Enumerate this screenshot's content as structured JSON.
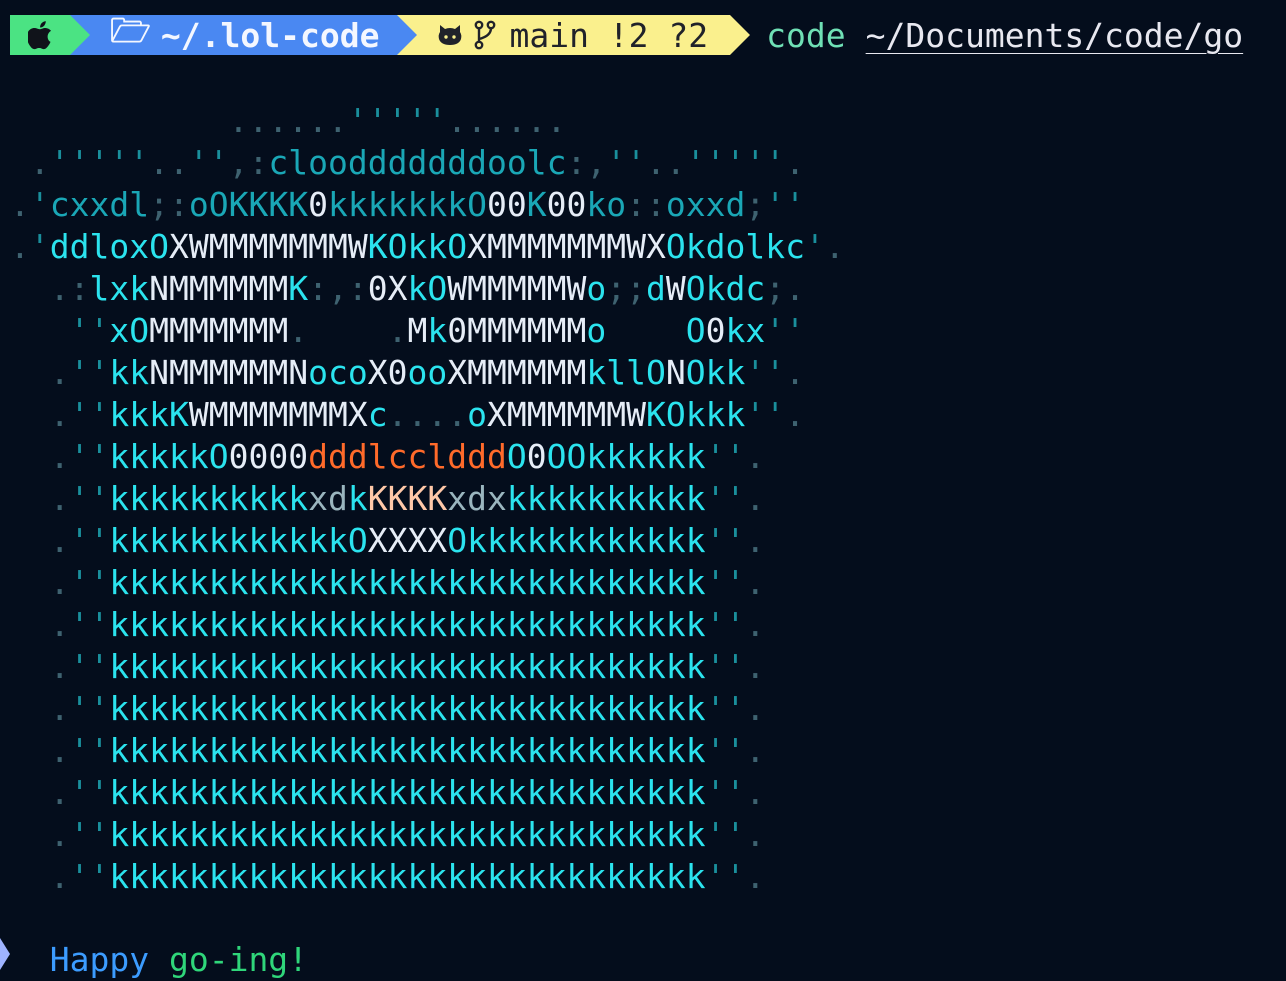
{
  "prompt": {
    "apple_icon": "apple-logo-icon",
    "dir_icon": "folder-open-icon",
    "dir_glyph": "🗁",
    "dir": "~/.lol-code",
    "github_icon": "github-icon",
    "branch_icon": "git-branch-icon",
    "git_status": "main !2 ?2",
    "command": "code",
    "argument": "~/Documents/code/go",
    "colors": {
      "apple_segment": "#4be383",
      "dir_segment": "#4a88f2",
      "git_segment": "#faf08d",
      "background": "#040d1c"
    }
  },
  "art_lines": [
    "           ......'''''......",
    " .'''''..'',:cloodddddddoolc:,''..'''''.",
    ".'cxxdl;:oOKKKK0kkkkkkkO00K00ko::oxxd;''",
    ".'ddloxOXWMMMMMMMWKOkkOXMMMMMMMWXOkdolkc'.",
    "  .:lxkNMMMMMMK:,:0XkOWMMMMMWo;;dWOkdc;.",
    "   ''xOMMMMMMM.    .Mk0MMMMMMo    O0kx''",
    "  .''kkNMMMMMMNocoX0ooXMMMMMMkllONOkk''.",
    "  .''kkkKWMMMMMMMXc....oXMMMMMMWKOkkk''.",
    "  .''kkkkkO0000dddlccldddO0OOkkkkkk''.",
    "  .''kkkkkkkkkkxdkKKKKxdxkkkkkkkkkk''.",
    "  .''kkkkkkkkkkkkOXXXXOkkkkkkkkkkkk''.",
    "  .''kkkkkkkkkkkkkkkkkkkkkkkkkkkkkk''.",
    "  .''kkkkkkkkkkkkkkkkkkkkkkkkkkkkkk''.",
    "  .''kkkkkkkkkkkkkkkkkkkkkkkkkkkkkk''.",
    "  .''kkkkkkkkkkkkkkkkkkkkkkkkkkkkkk''.",
    "  .''kkkkkkkkkkkkkkkkkkkkkkkkkkkkkk''.",
    "  .''kkkkkkkkkkkkkkkkkkkkkkkkkkkkkk''.",
    "  .''kkkkkkkkkkkkkkkkkkkkkkkkkkkkkk''.",
    "  .''kkkkkkkkkkkkkkkkkkkkkkkkkkkkkk''."
  ],
  "message": {
    "part1": "Happy",
    "part2": "go-ing!"
  }
}
